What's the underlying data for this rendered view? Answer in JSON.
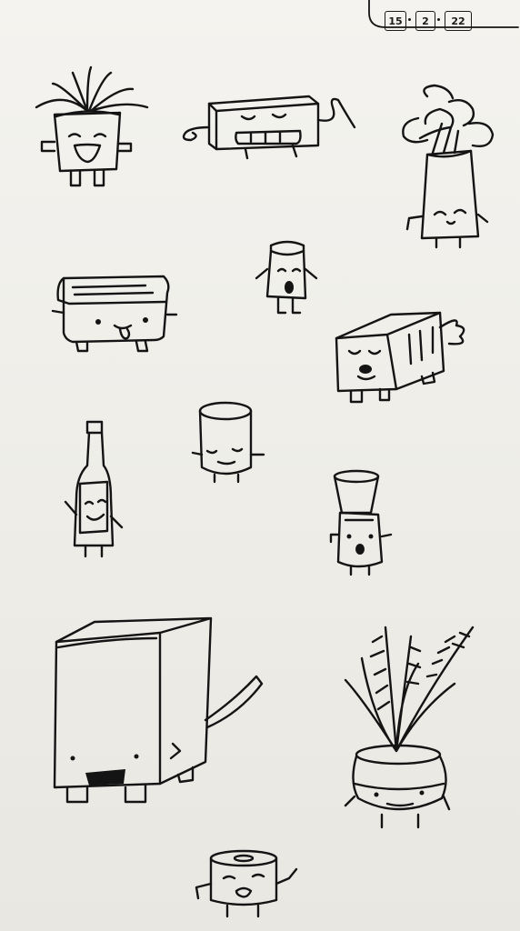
{
  "date_stamp": {
    "day": "15",
    "month": "2",
    "year": "22"
  },
  "colors": {
    "paper": "#f1f0ec",
    "ink": "#141414"
  }
}
